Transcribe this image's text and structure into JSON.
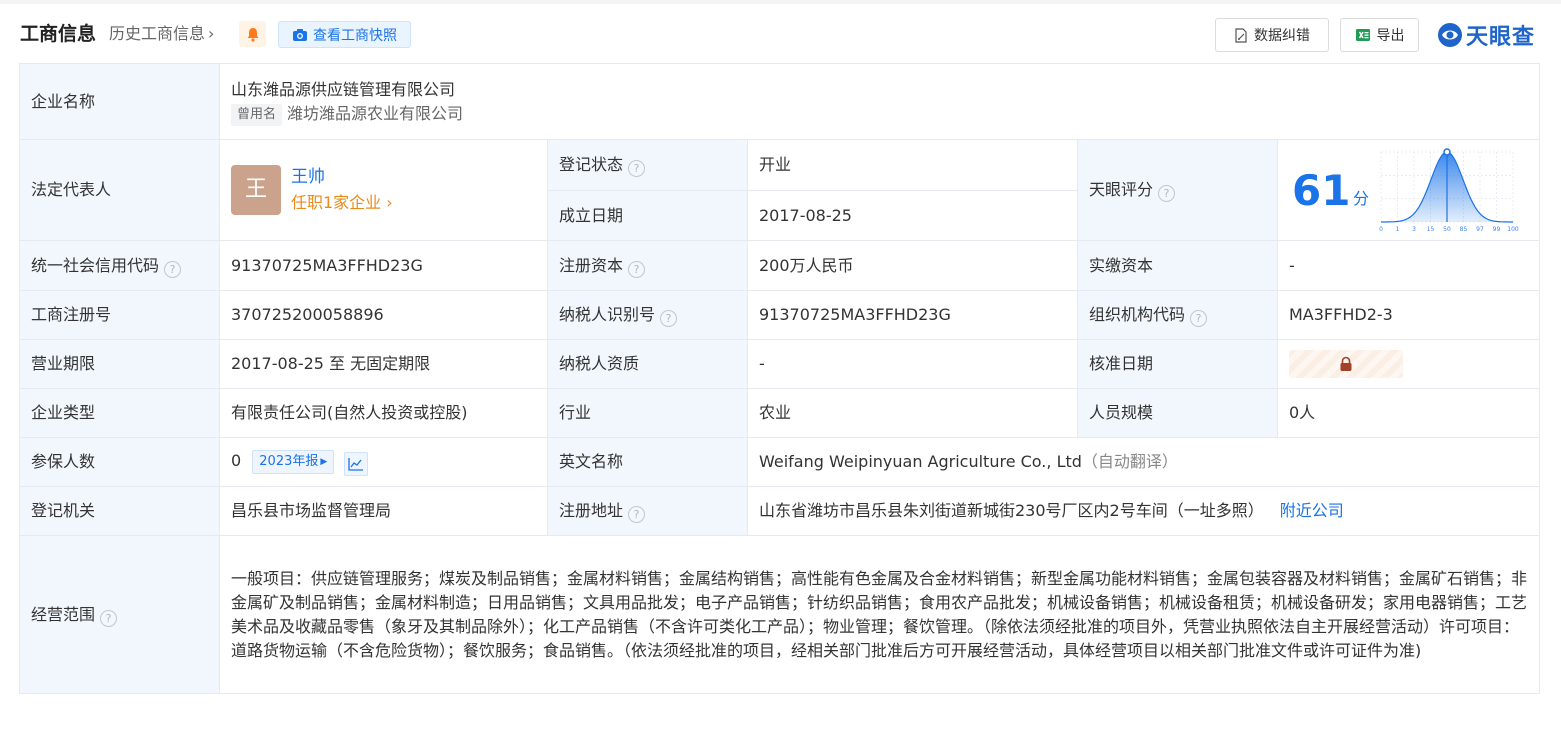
{
  "header": {
    "title": "工商信息",
    "history_link": "历史工商信息",
    "snapshot_button": "查看工商快照",
    "data_fix_button": "数据纠错",
    "export_button": "导出",
    "brand": "天眼查"
  },
  "company": {
    "name_label": "企业名称",
    "name": "山东潍品源供应链管理有限公司",
    "former_tag": "曾用名",
    "former_name": "潍坊潍品源农业有限公司"
  },
  "legal_rep": {
    "label": "法定代表人",
    "avatar_char": "王",
    "name": "王帅",
    "positions": "任职1家企业"
  },
  "status": {
    "label": "登记状态",
    "value": "开业"
  },
  "established": {
    "label": "成立日期",
    "value": "2017-08-25"
  },
  "score": {
    "label": "天眼评分",
    "value": "61",
    "unit": "分",
    "axis_ticks": [
      "0",
      "1",
      "3",
      "15",
      "50",
      "85",
      "97",
      "99",
      "100"
    ],
    "marker_percentile": 50
  },
  "credit_code": {
    "label": "统一社会信用代码",
    "value": "91370725MA3FFHD23G"
  },
  "reg_capital": {
    "label": "注册资本",
    "value": "200万人民币"
  },
  "paid_capital": {
    "label": "实缴资本",
    "value": "-"
  },
  "reg_number": {
    "label": "工商注册号",
    "value": "370725200058896"
  },
  "taxpayer_id": {
    "label": "纳税人识别号",
    "value": "91370725MA3FFHD23G"
  },
  "org_code": {
    "label": "组织机构代码",
    "value": "MA3FFHD2-3"
  },
  "term": {
    "label": "营业期限",
    "value": "2017-08-25 至 无固定期限"
  },
  "taxpayer_qual": {
    "label": "纳税人资质",
    "value": "-"
  },
  "approval_date": {
    "label": "核准日期"
  },
  "company_type": {
    "label": "企业类型",
    "value": "有限责任公司(自然人投资或控股)"
  },
  "industry": {
    "label": "行业",
    "value": "农业"
  },
  "staff_size": {
    "label": "人员规模",
    "value": "0人"
  },
  "insured": {
    "label": "参保人数",
    "value": "0",
    "report": "2023年报"
  },
  "english_name": {
    "label": "英文名称",
    "value": "Weifang Weipinyuan Agriculture Co., Ltd",
    "note": "（自动翻译）"
  },
  "reg_authority": {
    "label": "登记机关",
    "value": "昌乐县市场监督管理局"
  },
  "reg_address": {
    "label": "注册地址",
    "value": "山东省潍坊市昌乐县朱刘街道新城街230号厂区内2号车间（一址多照）",
    "nearby": "附近公司"
  },
  "scope": {
    "label": "经营范围",
    "value": "一般项目：供应链管理服务；煤炭及制品销售；金属材料销售；金属结构销售；高性能有色金属及合金材料销售；新型金属功能材料销售；金属包装容器及材料销售；金属矿石销售；非金属矿及制品销售；金属材料制造；日用品销售；文具用品批发；电子产品销售；针纺织品销售；食用农产品批发；机械设备销售；机械设备租赁；机械设备研发；家用电器销售；工艺美术品及收藏品零售（象牙及其制品除外）；化工产品销售（不含许可类化工产品）；物业管理；餐饮管理。（除依法须经批准的项目外，凭营业执照依法自主开展经营活动）许可项目：道路货物运输（不含危险货物）；餐饮服务；食品销售。（依法须经批准的项目，经相关部门批准后方可开展经营活动，具体经营项目以相关部门批准文件或许可证件为准)"
  },
  "colors": {
    "accent": "#1a73e8",
    "status_green": "#18a058",
    "label_bg": "#f2f7fd",
    "orange": "#e98a1c"
  }
}
